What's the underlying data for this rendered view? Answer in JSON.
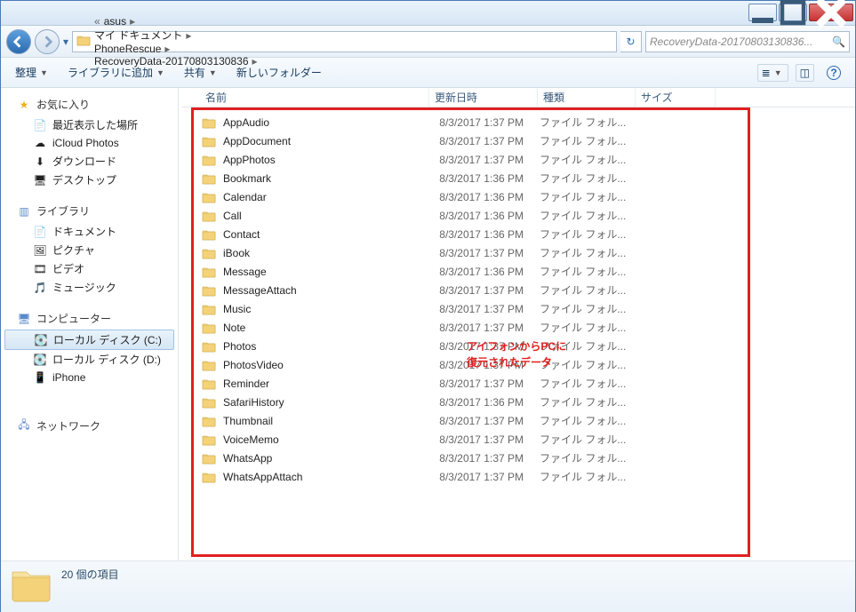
{
  "breadcrumb": [
    "asus",
    "マイ ドキュメント",
    "PhoneRescue",
    "RecoveryData-20170803130836"
  ],
  "search_placeholder": "RecoveryData-20170803130836...",
  "toolbar": {
    "organize": "整理",
    "addlib": "ライブラリに追加",
    "share": "共有",
    "newfolder": "新しいフォルダー"
  },
  "columns": {
    "name": "名前",
    "date": "更新日時",
    "type": "種類",
    "size": "サイズ"
  },
  "nav": {
    "favorites": {
      "label": "お気に入り",
      "items": [
        "最近表示した場所",
        "iCloud Photos",
        "ダウンロード",
        "デスクトップ"
      ]
    },
    "libraries": {
      "label": "ライブラリ",
      "items": [
        "ドキュメント",
        "ピクチャ",
        "ビデオ",
        "ミュージック"
      ]
    },
    "computer": {
      "label": "コンピューター",
      "items": [
        "ローカル ディスク (C:)",
        "ローカル ディスク (D:)",
        "iPhone",
        ""
      ]
    },
    "network": {
      "label": "ネットワーク"
    }
  },
  "type_label": "ファイル フォル...",
  "files": [
    {
      "name": "AppAudio",
      "date": "8/3/2017 1:37 PM"
    },
    {
      "name": "AppDocument",
      "date": "8/3/2017 1:37 PM"
    },
    {
      "name": "AppPhotos",
      "date": "8/3/2017 1:37 PM"
    },
    {
      "name": "Bookmark",
      "date": "8/3/2017 1:36 PM"
    },
    {
      "name": "Calendar",
      "date": "8/3/2017 1:36 PM"
    },
    {
      "name": "Call",
      "date": "8/3/2017 1:36 PM"
    },
    {
      "name": "Contact",
      "date": "8/3/2017 1:36 PM"
    },
    {
      "name": "iBook",
      "date": "8/3/2017 1:37 PM"
    },
    {
      "name": "Message",
      "date": "8/3/2017 1:36 PM"
    },
    {
      "name": "MessageAttach",
      "date": "8/3/2017 1:37 PM"
    },
    {
      "name": "Music",
      "date": "8/3/2017 1:37 PM"
    },
    {
      "name": "Note",
      "date": "8/3/2017 1:37 PM"
    },
    {
      "name": "Photos",
      "date": "8/3/2017 1:37 PM"
    },
    {
      "name": "PhotosVideo",
      "date": "8/3/2017 1:37 PM"
    },
    {
      "name": "Reminder",
      "date": "8/3/2017 1:37 PM"
    },
    {
      "name": "SafariHistory",
      "date": "8/3/2017 1:36 PM"
    },
    {
      "name": "Thumbnail",
      "date": "8/3/2017 1:37 PM"
    },
    {
      "name": "VoiceMemo",
      "date": "8/3/2017 1:37 PM"
    },
    {
      "name": "WhatsApp",
      "date": "8/3/2017 1:37 PM"
    },
    {
      "name": "WhatsAppAttach",
      "date": "8/3/2017 1:37 PM"
    }
  ],
  "overlay_lines": [
    "アイフォンからPCに",
    "復元されたデータ"
  ],
  "status_text": "20 個の項目"
}
